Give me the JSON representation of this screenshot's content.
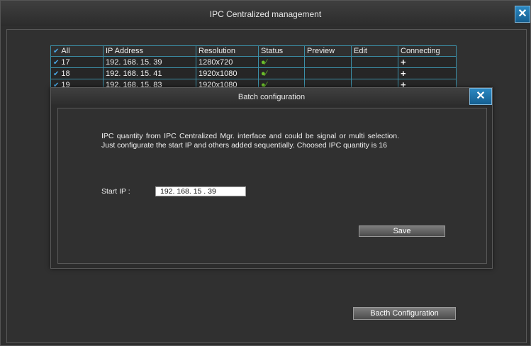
{
  "window": {
    "title": "IPC Centralized management",
    "close_glyph": "✕"
  },
  "table": {
    "headers": [
      "All",
      "IP Address",
      "Resolution",
      "Status",
      "Preview",
      "Edit",
      "Connecting"
    ],
    "rows": [
      {
        "num": "17",
        "ip": "192. 168. 15. 39",
        "resolution": "1280x720",
        "status_icon": "user-online-icon",
        "connect": "+"
      },
      {
        "num": "18",
        "ip": "192. 168. 15. 41",
        "resolution": "1920x1080",
        "status_icon": "user-online-icon",
        "connect": "+"
      },
      {
        "num": "19",
        "ip": "192. 168. 15. 83",
        "resolution": "1920x1080",
        "status_icon": "user-online-icon",
        "connect": "+"
      }
    ]
  },
  "dialog": {
    "title": "Batch configuration",
    "close_glyph": "✕",
    "description": "IPC quantity from IPC Centralized Mgr. interface and could be signal or multi selection. Just configurate the start IP and others added sequentially. Choosed IPC quantity is 16",
    "start_ip_label": "Start IP :",
    "start_ip_value": "192. 168. 15 . 39",
    "save_label": "Save"
  },
  "batch_button_label": "Bacth Configuration",
  "colors": {
    "accent_blue": "#1f74ad",
    "table_border": "#3c8fa8",
    "status_green": "#6bbf2a"
  }
}
